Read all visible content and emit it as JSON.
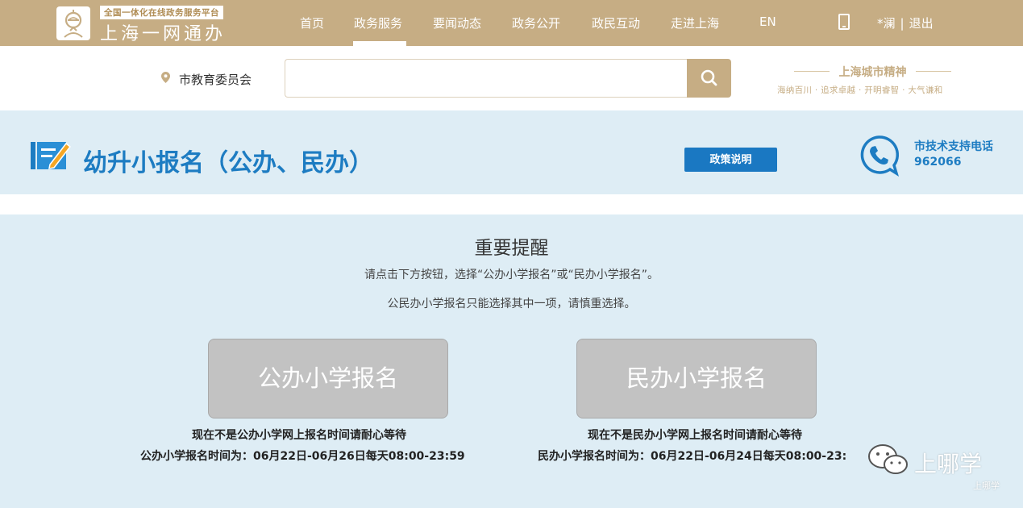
{
  "header": {
    "logo_subtitle": "全国一体化在线政务服务平台",
    "logo_title": "上海一网通办",
    "nav": [
      {
        "label": "首页"
      },
      {
        "label": "政务服务"
      },
      {
        "label": "要闻动态"
      },
      {
        "label": "政务公开"
      },
      {
        "label": "政民互动"
      },
      {
        "label": "走进上海"
      },
      {
        "label": "EN"
      }
    ],
    "active_nav": "政务服务",
    "user": "*澜",
    "separator": "|",
    "logout": "退出"
  },
  "search": {
    "location": "市教育委员会",
    "value": "",
    "placeholder": ""
  },
  "spirit": {
    "title": "上海城市精神",
    "subtitle": "海纳百川 · 追求卓越 · 开明睿智 · 大气谦和"
  },
  "service": {
    "title": "幼升小报名（公办、民办）",
    "policy_button": "政策说明",
    "support_label": "市技术支持电话",
    "support_number": "962066"
  },
  "notice": {
    "title": "重要提醒",
    "line1": "请点击下方按钮，选择“公办小学报名”或“民办小学报名”。",
    "line2": "公民办小学报名只能选择其中一项，请慎重选择。"
  },
  "public": {
    "button": "公办小学报名",
    "wait": "现在不是公办小学网上报名时间请耐心等待",
    "time": "公办小学报名时间为：06月22日-06月26日每天08:00-23:59"
  },
  "private": {
    "button": "民办小学报名",
    "wait": "现在不是民办小学网上报名时间请耐心等待",
    "time": "民办小学报名时间为：06月22日-06月24日每天08:00-23:"
  },
  "watermark": {
    "text": "上哪学",
    "small": "上哪学"
  },
  "colors": {
    "topbar": "#c6ad84",
    "band": "#deedf5",
    "accent_blue": "#1d7cc2",
    "button_gray": "#c2c2c2"
  }
}
